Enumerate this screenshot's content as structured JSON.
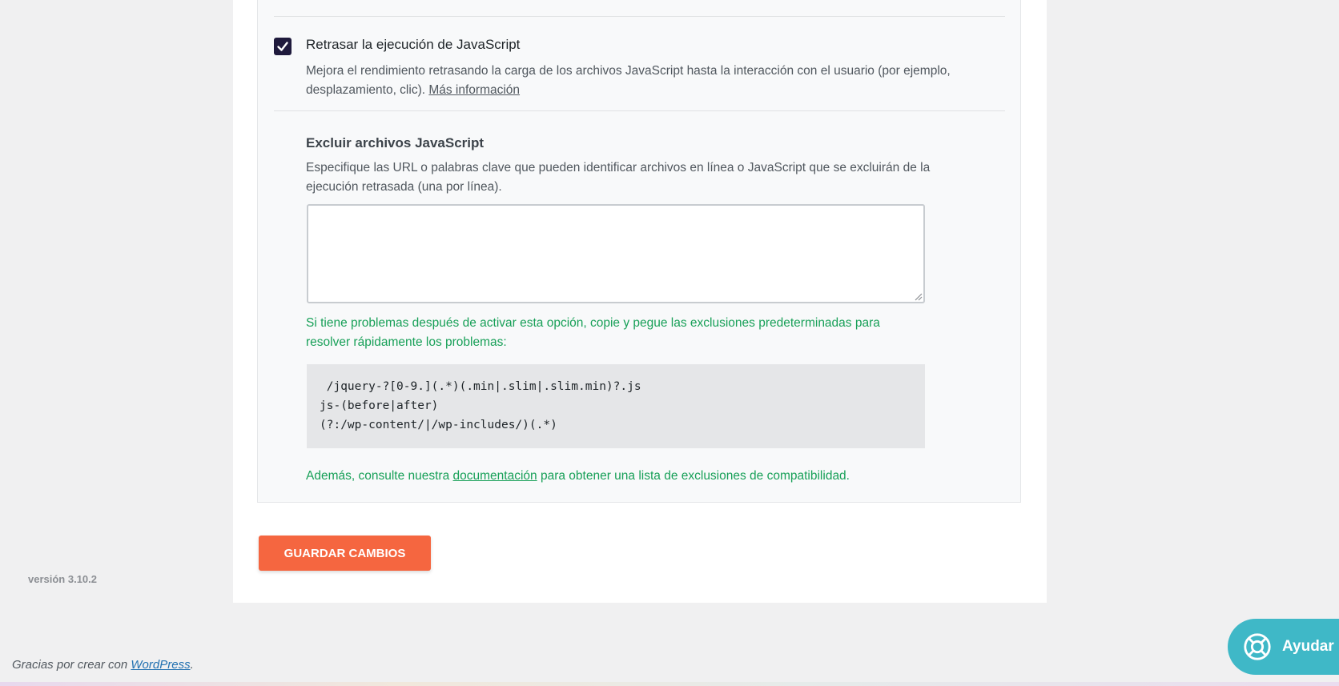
{
  "option": {
    "checked": true,
    "title": "Retrasar la ejecución de JavaScript",
    "description": "Mejora el rendimiento retrasando la carga de los archivos JavaScript hasta la interacción con el usuario (por ejemplo, desplazamiento, clic). ",
    "more_info_link": "Más información"
  },
  "exclude": {
    "title": "Excluir archivos JavaScript",
    "description": "Especifique las URL o palabras clave que pueden identificar archivos en línea o JavaScript que se excluirán de la ejecución retrasada (una por línea).",
    "textarea_value": "",
    "hint": "Si tiene problemas después de activar esta opción, copie y pegue las exclusiones predeterminadas para resolver rápidamente los problemas:",
    "code_lines": [
      " /jquery-?[0-9.](.*)(.min|.slim|.slim.min)?.js",
      "js-(before|after)",
      "(?:/wp-content/|/wp-includes/)(.*)"
    ],
    "compat_prefix": "Además, consulte nuestra ",
    "compat_link": "documentación",
    "compat_suffix": " para obtener una lista de exclusiones de compatibilidad."
  },
  "save_button": "GUARDAR CAMBIOS",
  "version": "versión 3.10.2",
  "footer": {
    "prefix": "Gracias por crear con ",
    "link": "WordPress",
    "suffix": "."
  },
  "help_button": {
    "label": "Ayudar",
    "icon": "lifebuoy-icon"
  },
  "colors": {
    "accent": "#f56640",
    "checkbox": "#1f1a3c",
    "hint_green": "#18a058",
    "help_teal": "#3fb8c7"
  }
}
